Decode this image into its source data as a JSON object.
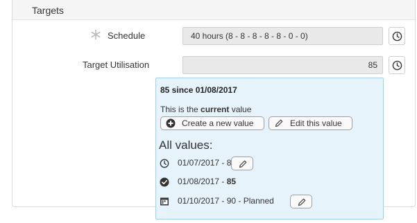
{
  "panel": {
    "title": "Targets"
  },
  "schedule": {
    "label": "Schedule",
    "value": "40 hours (8 - 8 - 8 - 8 - 8 - 0 - 0)"
  },
  "target_utilisation": {
    "label": "Target Utilisation",
    "value": "85"
  },
  "popup": {
    "title": "85 since 01/08/2017",
    "current_prefix": "This is the ",
    "current_word": "current",
    "current_suffix": " value",
    "create_label": "Create a new value",
    "edit_label": "Edit this value",
    "all_values_label": "All values:",
    "history": [
      {
        "date": "01/07/2017",
        "sep": " - ",
        "value": "80",
        "status": "",
        "icon": "clock-icon"
      },
      {
        "date": "01/08/2017",
        "sep": " - ",
        "value": "85",
        "status": "",
        "icon": "check-circle-icon"
      },
      {
        "date": "01/10/2017",
        "sep": " - ",
        "value": "90",
        "status": " - Planned",
        "icon": "calendar-icon"
      }
    ]
  },
  "colors": {
    "popup_background": "#e6f3fb",
    "popup_border": "#a8cde6",
    "field_background": "#e9e9e9"
  }
}
